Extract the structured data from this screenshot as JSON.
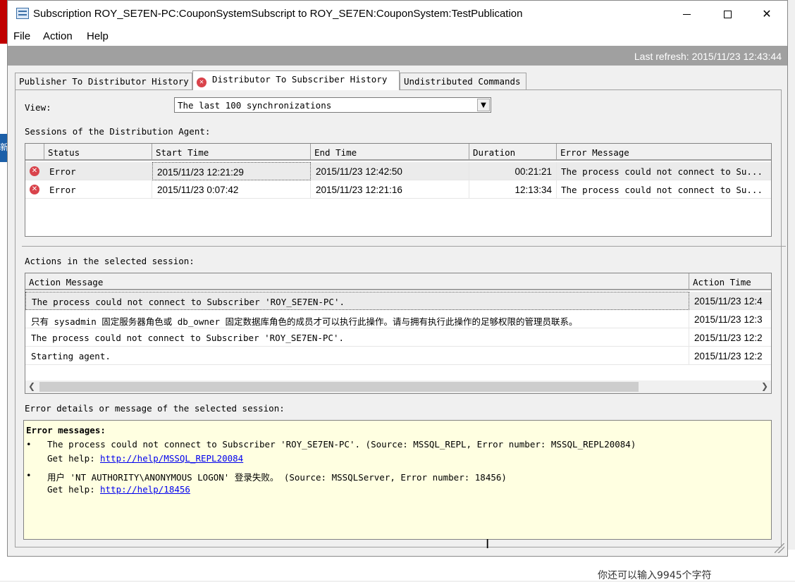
{
  "window": {
    "title": "Subscription ROY_SE7EN-PC:CouponSystemSubscript to ROY_SE7EN:CouponSystem:TestPublication"
  },
  "menu": [
    "File",
    "Action",
    "Help"
  ],
  "refresh": "Last refresh: 2015/11/23 12:43:44",
  "tabs": [
    {
      "label": "Publisher To Distributor History",
      "active": false
    },
    {
      "label": "Distributor To Subscriber History",
      "active": true,
      "icon": "error-icon"
    },
    {
      "label": "Undistributed Commands",
      "active": false
    }
  ],
  "view": {
    "label": "View:",
    "selected": "The last 100 synchronizations"
  },
  "sessions": {
    "label": "Sessions of the Distribution Agent:",
    "columns": [
      "Status",
      "Start Time",
      "End Time",
      "Duration",
      "Error Message"
    ],
    "rows": [
      {
        "status": "Error",
        "start": "2015/11/23 12:21:29",
        "end": "2015/11/23 12:42:50",
        "duration": "00:21:21",
        "message": "The process could not connect to Su..."
      },
      {
        "status": "Error",
        "start": "2015/11/23 0:07:42",
        "end": "2015/11/23 12:21:16",
        "duration": "12:13:34",
        "message": "The process could not connect to Su..."
      }
    ]
  },
  "actions": {
    "label": "Actions in the selected session:",
    "columns": [
      "Action Message",
      "Action Time"
    ],
    "rows": [
      {
        "message": "The process could not connect to Subscriber 'ROY_SE7EN-PC'.",
        "time": "2015/11/23 12:4"
      },
      {
        "message": "只有 sysadmin 固定服务器角色或 db_owner 固定数据库角色的成员才可以执行此操作。请与拥有执行此操作的足够权限的管理员联系。",
        "time": "2015/11/23 12:3"
      },
      {
        "message": "The process could not connect to Subscriber 'ROY_SE7EN-PC'.",
        "time": "2015/11/23 12:2"
      },
      {
        "message": "Starting agent.",
        "time": "2015/11/23 12:2"
      }
    ]
  },
  "details": {
    "label": "Error details or message of the selected session:",
    "heading": "Error messages:",
    "items": [
      {
        "text": "The process could not connect to Subscriber 'ROY_SE7EN-PC'. (Source: MSSQL_REPL, Error number: MSSQL_REPL20084)",
        "help_label": "Get help:",
        "link": "http://help/MSSQL_REPL20084"
      },
      {
        "text": "用户 'NT AUTHORITY\\ANONYMOUS LOGON' 登录失败。 (Source: MSSQLServer, Error number: 18456)",
        "help_label": "Get help:",
        "link": "http://help/18456"
      }
    ]
  },
  "background": {
    "left_text": "新",
    "bottom_text": "你还可以输入9945个字符"
  }
}
